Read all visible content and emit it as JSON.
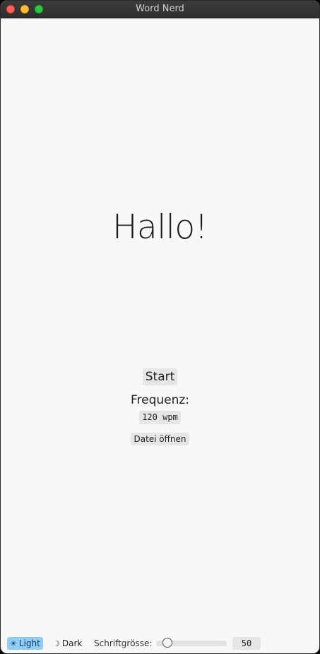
{
  "window": {
    "title": "Word Nerd"
  },
  "reader": {
    "current_word": "Hallo!"
  },
  "controls": {
    "start_label": "Start",
    "frequency_label": "Frequenz:",
    "frequency_value": "120 wpm",
    "open_file_label": "Datei öffnen"
  },
  "footer": {
    "light_icon": "sun-icon",
    "light_glyph": "☀",
    "light_label": "Light",
    "dark_icon": "moon-icon",
    "dark_glyph": "☽",
    "dark_label": "Dark",
    "font_size_label": "Schriftgrösse:",
    "font_size_value": "50",
    "font_size_slider_fraction": 0.1,
    "active_theme": "Light"
  },
  "colors": {
    "active_theme_bg": "#90cdf7",
    "window_bg": "#f8f8f8",
    "button_bg": "#e6e6e6"
  }
}
